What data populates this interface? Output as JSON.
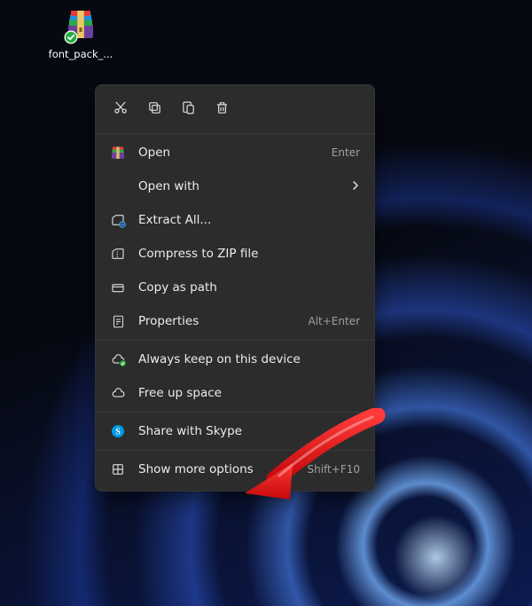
{
  "desktop_icon": {
    "filename": "font_pack_..."
  },
  "context_menu": {
    "quick_actions": [
      {
        "name": "cut-icon"
      },
      {
        "name": "copy-icon"
      },
      {
        "name": "paste-icon"
      },
      {
        "name": "delete-icon"
      }
    ],
    "group1": [
      {
        "label": "Open",
        "accel": "Enter",
        "icon": "winrar-icon"
      },
      {
        "label": "Open with",
        "submenu": true,
        "icon": "blank-icon"
      },
      {
        "label": "Extract All...",
        "icon": "extract-icon"
      },
      {
        "label": "Compress to ZIP file",
        "icon": "compress-icon"
      },
      {
        "label": "Copy as path",
        "icon": "copy-path-icon"
      },
      {
        "label": "Properties",
        "accel": "Alt+Enter",
        "icon": "properties-icon"
      }
    ],
    "group2": [
      {
        "label": "Always keep on this device",
        "icon": "cloud-keep-icon"
      },
      {
        "label": "Free up space",
        "icon": "cloud-icon"
      }
    ],
    "group3": [
      {
        "label": "Share with Skype",
        "icon": "skype-icon"
      }
    ],
    "group4": [
      {
        "label": "Show more options",
        "accel": "Shift+F10",
        "icon": "more-options-icon"
      }
    ]
  }
}
